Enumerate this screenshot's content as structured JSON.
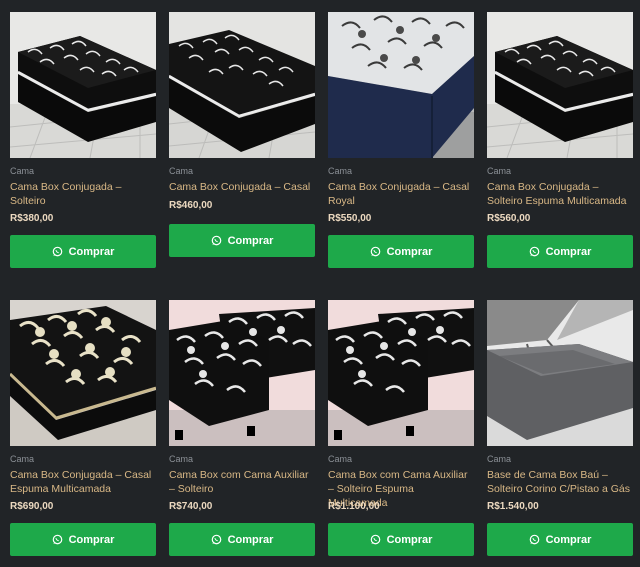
{
  "products": [
    {
      "category": "Cama",
      "name": "Cama Box Conjugada – Solteiro",
      "price": "R$380,00",
      "buy_label": "Comprar",
      "image": "single-box-bed-black-floral-photo"
    },
    {
      "category": "Cama",
      "name": "Cama Box Conjugada – Casal",
      "price": "R$460,00",
      "buy_label": "Comprar",
      "image": "double-box-bed-black-floral-photo"
    },
    {
      "category": "Cama",
      "name": "Cama Box Conjugada – Casal Royal",
      "price": "R$550,00",
      "buy_label": "Comprar",
      "image": "box-bed-gray-floral-navy-base-photo"
    },
    {
      "category": "Cama",
      "name": "Cama Box Conjugada – Solteiro Espuma Multicamada",
      "price": "R$560,00",
      "buy_label": "Comprar",
      "image": "single-box-bed-black-floral-photo"
    },
    {
      "category": "Cama",
      "name": "Cama Box Conjugada – Casal Espuma Multicamada",
      "price": "R$690,00",
      "buy_label": "Comprar",
      "image": "double-box-bed-cream-floral-photo"
    },
    {
      "category": "Cama",
      "name": "Cama Box com Cama Auxiliar – Solteiro",
      "price": "R$740,00",
      "buy_label": "Comprar",
      "image": "trundle-bed-black-floral-photo"
    },
    {
      "category": "Cama",
      "name": "Cama Box com Cama Auxiliar – Solteiro Espuma Multicamada",
      "price": "R$1.100,00",
      "buy_label": "Comprar",
      "image": "trundle-bed-black-floral-photo"
    },
    {
      "category": "Cama",
      "name": "Base de Cama Box Baú – Solteiro Corino C/Pistao a Gás",
      "price": "R$1.540,00",
      "buy_label": "Comprar",
      "image": "storage-bed-base-gray-photo"
    }
  ],
  "colors": {
    "background": "#212427",
    "button": "#1ea94a",
    "title": "#d9b886",
    "price": "#ecd9c0",
    "category": "#8b9096"
  },
  "icons": {
    "buy": "whatsapp-icon"
  }
}
